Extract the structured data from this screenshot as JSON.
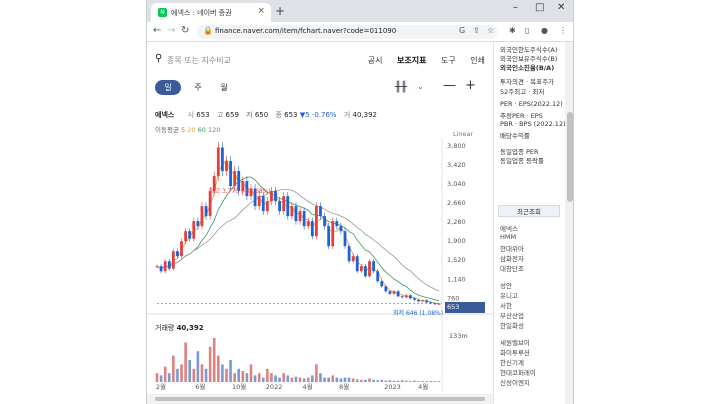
{
  "browser": {
    "tab_title": "에넥스 : 네이버 증권",
    "url": "finance.naver.com/item/fchart.naver?code=011090",
    "new_tab": "+",
    "close_tab": "×",
    "win_minimize": "–",
    "win_maximize": "□",
    "win_close": "✕"
  },
  "search": {
    "placeholder": "종목 또는 지수비교"
  },
  "topnav": {
    "item1": "공시",
    "item2": "보조지표",
    "item3": "도구",
    "item4": "인쇄"
  },
  "period": {
    "day": "일",
    "week": "주",
    "month": "월"
  },
  "quote": {
    "name": "에넥스",
    "open_label": "시",
    "open": "653",
    "high_label": "고",
    "high": "659",
    "low_label": "저",
    "low": "650",
    "close_label": "종",
    "close": "653",
    "change": "▼5 -0.76%",
    "volume_label": "거",
    "volume": "40,392"
  },
  "ma": {
    "label": "이동평균",
    "m5": "5",
    "m20": "20",
    "m60": "60",
    "m120": "120"
  },
  "scale_label": "Linear",
  "chart_labels": {
    "max": "최고 3,770 (-82.68%)",
    "min": "최저 646 (1.08%)",
    "current": "653",
    "volume_title": "거래량",
    "volume_value": "40,392",
    "volume_scale": "133m"
  },
  "chart_data": {
    "type": "line",
    "y_ticks": [
      "3,800",
      "3,420",
      "3,040",
      "2,660",
      "2,280",
      "1,900",
      "1,520",
      "1,140",
      "760"
    ],
    "x_ticks": [
      "2월",
      "6월",
      "10월",
      "2022",
      "4월",
      "8월",
      "2023",
      "4월"
    ],
    "ylim": [
      646,
      3800
    ],
    "series": [
      {
        "values": [
          1400,
          1300,
          1500,
          1350,
          1700,
          1600,
          1900,
          2100,
          1950,
          2300,
          2200,
          2600,
          2400,
          2900,
          3200,
          3770,
          3300,
          3500,
          3000,
          3300,
          2900,
          3100,
          2800,
          2950,
          2600,
          2800,
          2500,
          2700,
          2900,
          2700,
          2500,
          2800,
          2400,
          2600,
          2300,
          2500,
          2200,
          2300,
          2000,
          2600,
          2400,
          2200,
          1800,
          2300,
          2200,
          2100,
          1800,
          1500,
          1600,
          1300,
          1400,
          1200,
          1500,
          1300,
          1100,
          1000,
          900,
          850,
          900,
          800,
          780,
          820,
          760,
          730,
          700,
          720,
          680,
          660,
          650,
          653
        ]
      }
    ],
    "volume": [
      0.2,
      0.15,
      0.35,
      0.2,
      0.6,
      0.3,
      0.4,
      0.9,
      0.5,
      0.3,
      0.7,
      0.4,
      0.3,
      0.8,
      1.0,
      0.6,
      0.4,
      0.3,
      0.5,
      0.2,
      0.3,
      0.25,
      0.2,
      0.4,
      0.15,
      0.2,
      0.1,
      0.3,
      0.2,
      0.15,
      0.1,
      0.2,
      0.15,
      0.1,
      0.12,
      0.1,
      0.08,
      0.1,
      0.15,
      0.4,
      0.2,
      0.1,
      0.1,
      0.15,
      0.1,
      0.08,
      0.1,
      0.1,
      0.08,
      0.06,
      0.05,
      0.05,
      0.08,
      0.05,
      0.04,
      0.05,
      0.03,
      0.04,
      0.03,
      0.03,
      0.04,
      0.03,
      0.02,
      0.03,
      0.02,
      0.02,
      0.02,
      0.02,
      0.02,
      0.02
    ]
  },
  "side": {
    "rows": [
      "외국인한도주식수(A)",
      "외국인보유주식수(B)",
      "외국인소진율(B/A)",
      "투자의견 · 목표주가",
      "52주최고 · 최저",
      "PER · EPS(2022.12)",
      "추정PER · EPS",
      "PBR · BPS (2022.12)",
      "배당수익률",
      "동일업종 PER",
      "동일업종 등락률"
    ],
    "recent_title": "최근조회",
    "recent": [
      "에넥스",
      "HMM",
      "현대위아",
      "삼화전자",
      "대창단조",
      "성안",
      "유니고",
      "서한",
      "부산산업",
      "한일화성",
      "세원벨브이",
      "화이투루션",
      "한신기계",
      "현대코퍼레이",
      "신성이엔지"
    ]
  }
}
